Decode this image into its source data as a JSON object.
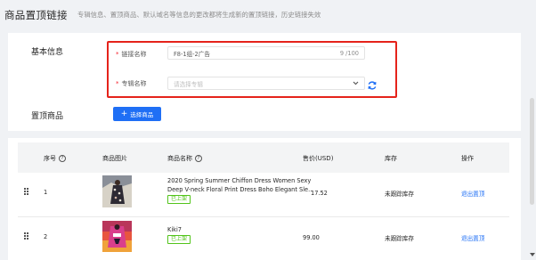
{
  "header": {
    "title": "商品置顶链接",
    "description": "专辑信息、置顶商品、默认域名等信息的更改都将生成新的置顶链接，历史链接失效"
  },
  "basic": {
    "section_label": "基本信息",
    "link_name": {
      "label": "链接名称",
      "value": "F8-1组-2广告",
      "count": "9 /100"
    },
    "album_name": {
      "label": "专辑名称",
      "placeholder": "请选择专辑"
    }
  },
  "pinned": {
    "section_label": "置顶商品",
    "add_button": "选择商品"
  },
  "table": {
    "headers": {
      "index": "序号",
      "image": "商品图片",
      "name": "商品名称",
      "price": "售价(USD)",
      "stock": "库存",
      "action": "操作"
    },
    "rows": [
      {
        "index": "1",
        "name_line1": "2020 Spring Summer Chiffon Dress Women Sexy",
        "name_line2": "Deep V-neck Floral Print Dress Boho Elegant Sle...",
        "status": "已上架",
        "price": "17.52",
        "stock": "未跟踪库存",
        "action": "退出置顶"
      },
      {
        "index": "2",
        "name_line1": "Kiki7",
        "name_line2": "",
        "status": "已上架",
        "price": "99.00",
        "stock": "未跟踪库存",
        "action": "退出置顶"
      }
    ]
  },
  "colors": {
    "primary": "#1f6ff5",
    "required_star": "#f5222d",
    "highlight_border": "#e5231b",
    "status_green": "#52c41a",
    "page_bg": "#f0f2f5"
  },
  "icons": {
    "refresh": "refresh-icon",
    "chevron": "chevron-down-icon",
    "help": "question-circle-icon",
    "drag": "drag-handle-icon"
  }
}
